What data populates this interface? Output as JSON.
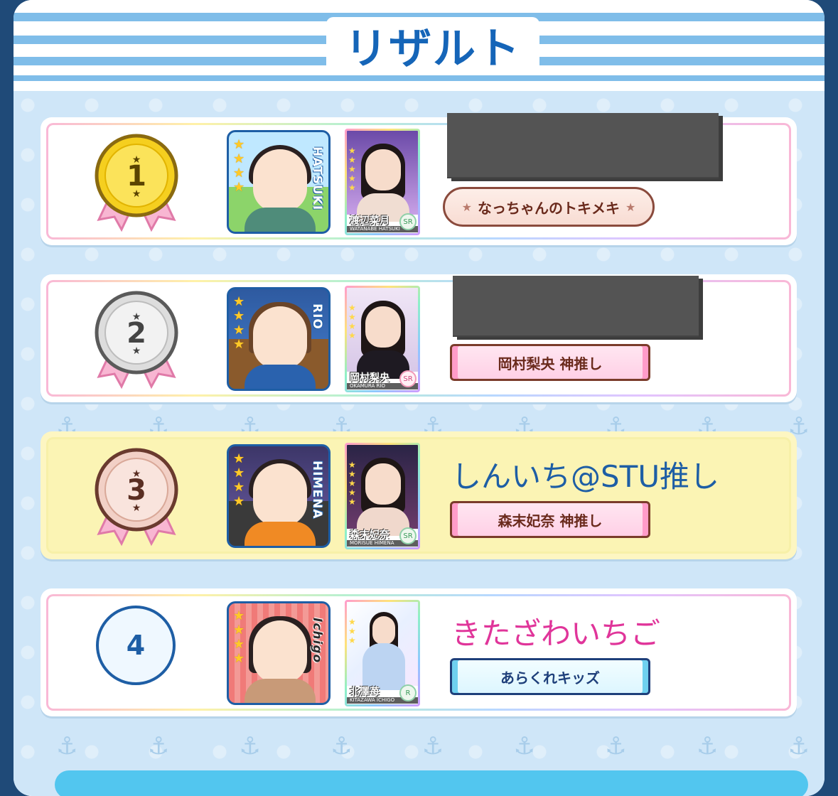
{
  "header": {
    "title": "リザルト"
  },
  "rows": [
    {
      "rank": "1",
      "avatar_name": "HATSUKI",
      "card_name": "渡辺菜月",
      "card_romaji": "WATANABE HATSUKI",
      "card_rarity": "SR",
      "player_name": "",
      "title_badge": "なっちゃんのトキメキ",
      "badge_style": "ribbon",
      "name_redacted": true
    },
    {
      "rank": "2",
      "avatar_name": "RIO",
      "card_name": "岡村梨央",
      "card_romaji": "OKAMURA RIO",
      "card_rarity": "SR",
      "player_name": "",
      "title_badge": "岡村梨央 神推し",
      "badge_style": "pink",
      "name_redacted": true
    },
    {
      "rank": "3",
      "avatar_name": "HIMENA",
      "card_name": "森末妃奈",
      "card_romaji": "MORISUE HIMENA",
      "card_rarity": "SR",
      "player_name": "しんいち@STU推し",
      "title_badge": "森末妃奈 神推し",
      "badge_style": "pink",
      "name_redacted": false,
      "highlighted": true
    },
    {
      "rank": "4",
      "avatar_name": "Ichigo",
      "card_name": "北澤苺",
      "card_romaji": "KITAZAWA ICHIGO",
      "card_rarity": "R",
      "player_name": "きたざわいちご",
      "title_badge": "あらくれキッズ",
      "badge_style": "blue",
      "name_redacted": false
    }
  ],
  "colors": {
    "title": "#1565b8",
    "player_name_3": "#1e5ea5",
    "player_name_4": "#e0359a",
    "gold": "#f5cf1f",
    "silver": "#dddddd",
    "bronze": "#f2d0c6"
  }
}
